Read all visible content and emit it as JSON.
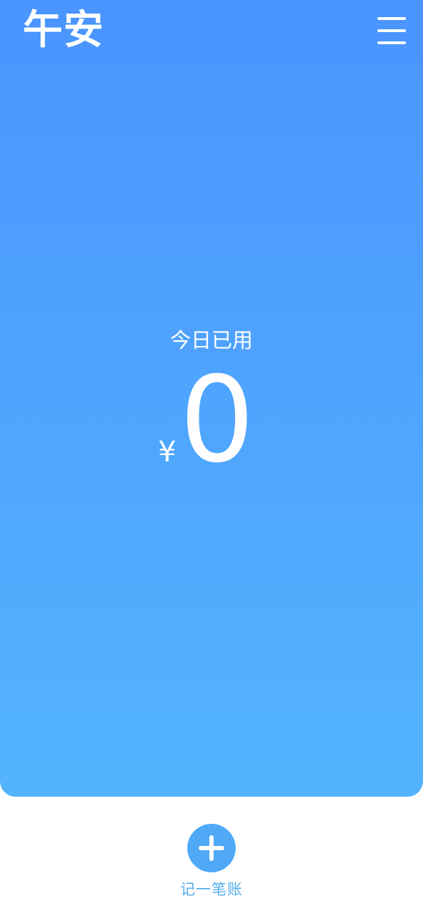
{
  "header": {
    "greeting": "午安",
    "menu_icon": "hamburger-menu-icon"
  },
  "summary": {
    "label": "今日已用",
    "currency": "¥",
    "amount": "0"
  },
  "actions": {
    "add_icon": "plus-icon",
    "add_label": "记一笔账"
  },
  "colors": {
    "hero_top": "#4A94FE",
    "hero_bottom": "#53B4FD",
    "accent": "#4FA9F7",
    "accent_text": "#55AEEC",
    "text_on_hero": "#ffffff",
    "background": "#ffffff"
  }
}
